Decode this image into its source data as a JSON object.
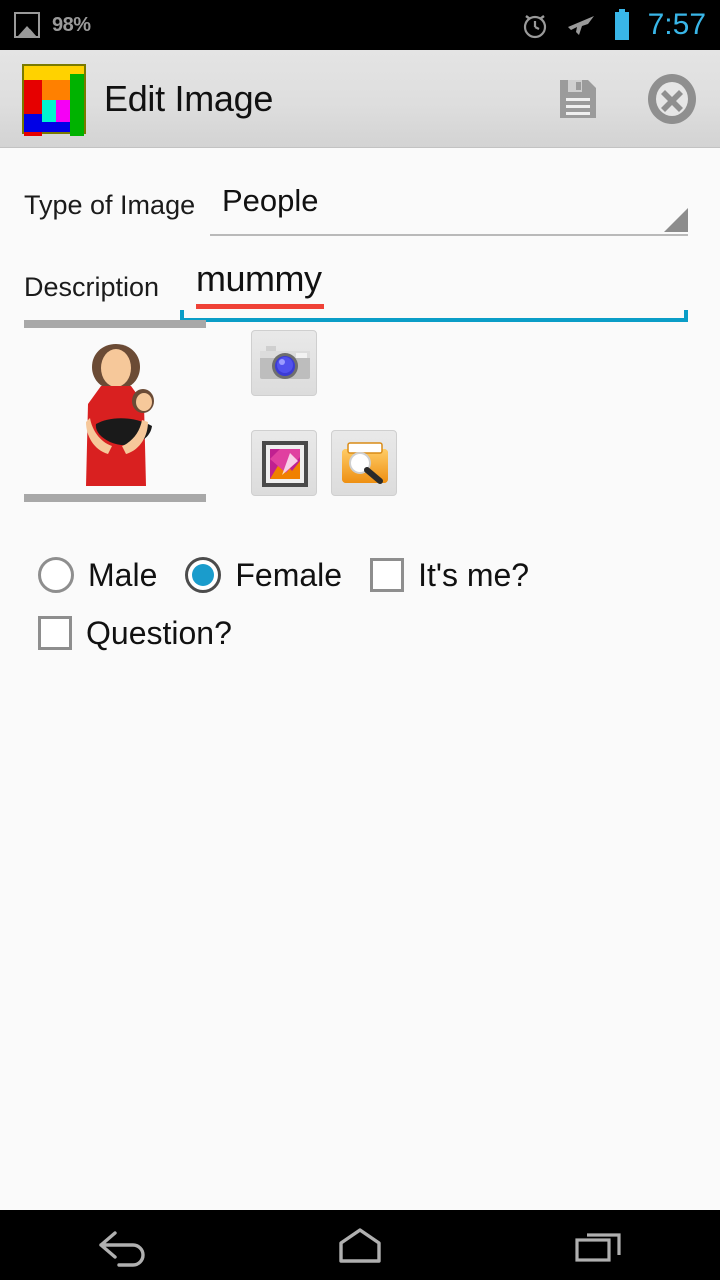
{
  "status_bar": {
    "photo_icon": "photo-icon",
    "battery_percent": "98%",
    "alarm_icon": "alarm-clock-icon",
    "airplane_icon": "airplane-mode-icon",
    "battery_icon": "battery-icon",
    "time": "7:57",
    "time_color": "#39b6e8",
    "background": "#000000"
  },
  "app_bar": {
    "logo_icon": "app-logo-icon",
    "title": "Edit Image",
    "save_icon": "save-icon",
    "close_icon": "close-icon",
    "background": "#dedede"
  },
  "form": {
    "type_label": "Type of Image",
    "type_value": "People",
    "type_dropdown_icon": "dropdown-triangle-icon",
    "description_label": "Description",
    "description_value": "mummy",
    "description_spellcheck_color": "#ef4136",
    "description_focus_color": "#0a9dc7"
  },
  "image_panel": {
    "thumbnail_icon": "mother-and-baby-pictogram",
    "divider_color": "#a8a8a8",
    "buttons": [
      {
        "name": "camera-button",
        "icon": "camera-icon"
      },
      {
        "name": "gallery-button",
        "icon": "gallery-icon"
      },
      {
        "name": "browse-button",
        "icon": "folder-search-icon"
      }
    ]
  },
  "choices": {
    "accent_color": "#1a9ccc",
    "row1": [
      {
        "type": "radio",
        "label": "Male",
        "selected": false
      },
      {
        "type": "radio",
        "label": "Female",
        "selected": true
      },
      {
        "type": "checkbox",
        "label": "It's me?",
        "checked": false
      }
    ],
    "row2": [
      {
        "type": "checkbox",
        "label": "Question?",
        "checked": false
      }
    ]
  },
  "nav_bar": {
    "back_icon": "back-icon",
    "home_icon": "home-icon",
    "recents_icon": "recent-apps-icon",
    "background": "#000000"
  }
}
